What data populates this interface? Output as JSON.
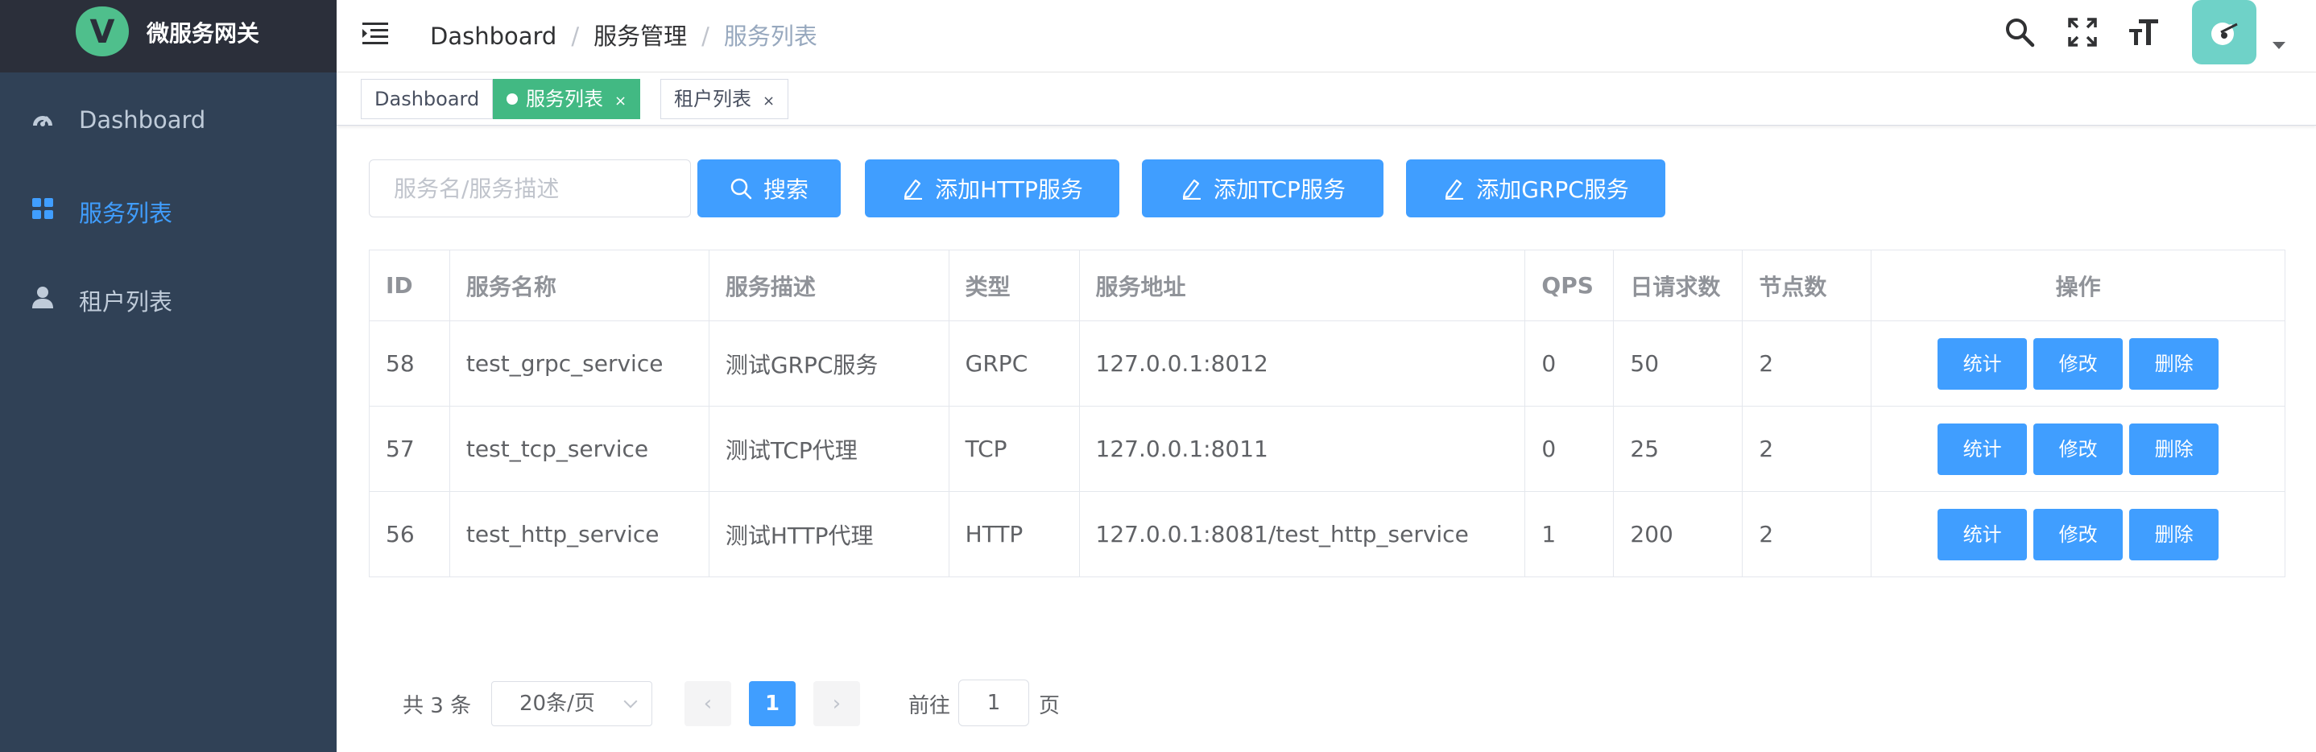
{
  "brand": {
    "title": "微服务网关",
    "logo_letter": "V"
  },
  "sidebar": {
    "items": [
      {
        "label": "Dashboard",
        "icon": "dashboard-icon",
        "active": false
      },
      {
        "label": "服务列表",
        "icon": "grid-icon",
        "active": true
      },
      {
        "label": "租户列表",
        "icon": "user-icon",
        "active": false
      }
    ]
  },
  "navbar": {
    "breadcrumb": [
      "Dashboard",
      "服务管理",
      "服务列表"
    ],
    "icons": [
      "search-icon",
      "fullscreen-icon",
      "font-size-icon"
    ]
  },
  "tags": [
    {
      "label": "Dashboard",
      "active": false,
      "closable": false
    },
    {
      "label": "服务列表",
      "active": true,
      "closable": true
    },
    {
      "label": "租户列表",
      "active": false,
      "closable": true
    }
  ],
  "tag_close": "×",
  "filter": {
    "search_placeholder": "服务名/服务描述",
    "search_button": "搜索",
    "add_http": "添加HTTP服务",
    "add_tcp": "添加TCP服务",
    "add_grpc": "添加GRPC服务"
  },
  "table": {
    "headers": [
      "ID",
      "服务名称",
      "服务描述",
      "类型",
      "服务地址",
      "QPS",
      "日请求数",
      "节点数",
      "操作"
    ],
    "rows": [
      {
        "id": "58",
        "name": "test_grpc_service",
        "desc": "测试GRPC服务",
        "type": "GRPC",
        "addr": "127.0.0.1:8012",
        "qps": "0",
        "daily": "50",
        "nodes": "2"
      },
      {
        "id": "57",
        "name": "test_tcp_service",
        "desc": "测试TCP代理",
        "type": "TCP",
        "addr": "127.0.0.1:8011",
        "qps": "0",
        "daily": "25",
        "nodes": "2"
      },
      {
        "id": "56",
        "name": "test_http_service",
        "desc": "测试HTTP代理",
        "type": "HTTP",
        "addr": "127.0.0.1:8081/test_http_service",
        "qps": "1",
        "daily": "200",
        "nodes": "2"
      }
    ],
    "row_actions": [
      "统计",
      "修改",
      "删除"
    ]
  },
  "pagination": {
    "total_text": "共 3 条",
    "page_size": "20条/页",
    "current_page": "1",
    "prev": "‹",
    "next": "›",
    "goto_label": "前往",
    "goto_value": "1",
    "page_suffix": "页"
  },
  "colors": {
    "primary": "#409eff",
    "sidebar_bg": "#304156",
    "logo_bg": "#2b2f3a",
    "tag_active": "#42b983"
  }
}
